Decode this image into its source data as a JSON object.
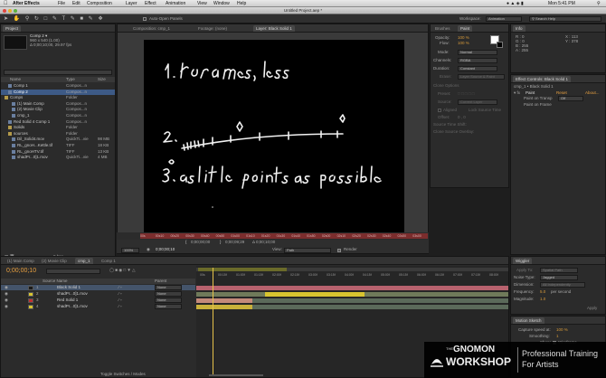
{
  "menubar": {
    "app": "After Effects",
    "menus": [
      "File",
      "Edit",
      "Composition",
      "Layer",
      "Effect",
      "Animation",
      "View",
      "Window",
      "Help"
    ],
    "title": "Untitled Project.aep *",
    "clock": "Mon 5:41 PM"
  },
  "toolbar": {
    "auto_open": "Auto-Open Panels",
    "workspace_label": "Workspace:",
    "workspace_value": "Animation",
    "search_placeholder": "Search Help"
  },
  "project": {
    "tab": "Project",
    "comp_name": "Comp 2 ▾",
    "comp_size": "960 x 540 (1.00)",
    "comp_duration": "Δ 0;00;10;00, 29.97 fps",
    "columns": {
      "name": "Name",
      "type": "Type",
      "size": "Size"
    },
    "items": [
      {
        "name": "Comp 1",
        "type": "Compos...n"
      },
      {
        "name": "Comp 2",
        "type": "Compos...n",
        "selected": true
      },
      {
        "name": "Comps",
        "type": "Folder"
      },
      {
        "name": "(1) Main Comp",
        "type": "Compos...n"
      },
      {
        "name": "(2) Movie Clip",
        "type": "Compos...n"
      },
      {
        "name": "cmp_1",
        "type": "Compos...n"
      },
      {
        "name": "Red Solid 4 Comp 1",
        "type": "Compos...n"
      },
      {
        "name": "Solids",
        "type": "Folder"
      },
      {
        "name": "sources",
        "type": "Folder"
      },
      {
        "name": "Dil_Solid4.mov",
        "type": "QuickTi...vie",
        "size": "98 MB"
      },
      {
        "name": "RL_gnoH...Kettle.tif",
        "type": "TIFF",
        "size": "18 KB"
      },
      {
        "name": "RL_gnoHTV.tif",
        "type": "TIFF",
        "size": "13 KB"
      },
      {
        "name": "shadPr...0]1.mov",
        "type": "QuickTi...vie",
        "size": "4 MB"
      }
    ],
    "bpc": "8 bpc"
  },
  "viewer": {
    "tabs": [
      "Composition: cmp_1",
      "Footage: (none)",
      "Layer: Black Solid 1"
    ],
    "handwriting": [
      "1. keyframes, less",
      "2.",
      "3. as little points as possible"
    ],
    "ruler_labels": [
      "00s",
      "00s10",
      "00s20",
      "00s30",
      "00s40",
      "00s50",
      "01s00",
      "01s10",
      "01s20",
      "01s30",
      "01s40",
      "01s50",
      "02s00",
      "02s10",
      "02s20",
      "02s30",
      "02s40",
      "02s50",
      "03s00"
    ],
    "in_time": "0;00;00;00",
    "out_time": "0;00;09;29",
    "duration": "Δ 0;00;10;00",
    "zoom": "100%",
    "current_time": "0;00;00;10",
    "view_label": "View:",
    "view_value": "Path",
    "render_label": "Render"
  },
  "brushes": {
    "tabs": [
      "Brushes",
      "Paint"
    ],
    "opacity_label": "Opacity:",
    "opacity_value": "100 %",
    "flow_label": "Flow:",
    "flow_value": "100 %",
    "mode_label": "Mode:",
    "mode_value": "Normal",
    "channels_label": "Channels:",
    "channels_value": "RGBA",
    "duration_label": "Duration:",
    "duration_value": "Constant",
    "erase_label": "Erase:",
    "erase_value": "Layer Source & Paint",
    "clone_options": "Clone Options",
    "preset_label": "Preset:",
    "source_label": "Source:",
    "source_value": "Current Layer",
    "aligned": "Aligned",
    "lock_source_time": "Lock Source Time",
    "offset_label": "Offset:",
    "offset_value": "0 , 0",
    "source_time_shift": "Source Time Shift:",
    "clone_source_overlay": "Clone Source Overlay:"
  },
  "info": {
    "tab": "Info",
    "r": "R : 0",
    "g": "G : 0",
    "b": "B : 255",
    "a": "A : 255",
    "x": "X : 113",
    "y": "Y : 378"
  },
  "effect_controls": {
    "tab": "Effect Controls: Black Solid 1",
    "path": "cmp_1 • Black Solid 1",
    "effect": "Paint",
    "reset": "Reset",
    "about": "About...",
    "on_transparent": "Paint on Transp",
    "on_transparent_value": "Off",
    "paint_on_frame": "Paint on Frame"
  },
  "wiggler": {
    "tab": "Wiggler",
    "apply_to_label": "Apply To:",
    "apply_to_value": "Spatial Path",
    "noise_type_label": "Noise Type:",
    "noise_type_value": "Jagged",
    "dimension_label": "Dimension:",
    "dimension_value": "All Independently",
    "frequency_label": "Frequency:",
    "frequency_value": "5.0",
    "frequency_unit": "per second",
    "magnitude_label": "Magnitude:",
    "magnitude_value": "1.0",
    "apply": "Apply"
  },
  "motion_sketch": {
    "tab": "Motion Sketch",
    "capture_label": "Capture speed at:",
    "capture_value": "100 %",
    "smoothing_label": "Smoothing:",
    "smoothing_value": "1",
    "show_label": "Show:",
    "show_value": "Wireframe"
  },
  "timeline": {
    "tabs": [
      "(1) Main Comp",
      "(2) Movie Clip",
      "cmp_1",
      "Comp 1"
    ],
    "timecode": "0;00;00;10",
    "column_header": "Source Name",
    "parent_header": "Parent",
    "layers": [
      {
        "num": "1",
        "name": "Black Solid 1",
        "color": "#1a1a1a",
        "parent": "None"
      },
      {
        "num": "2",
        "name": "shadPr...0]1.mov",
        "color": "#d8c430",
        "parent": "None"
      },
      {
        "num": "3",
        "name": "Red Solid 1",
        "color": "#c23030",
        "parent": "None"
      },
      {
        "num": "4",
        "name": "shadPr...0]1.mov",
        "color": "#d8c430",
        "parent": "None"
      }
    ],
    "ruler": [
      "00s",
      "00:15f",
      "01:00f",
      "01:15f",
      "02:00f",
      "02:15f",
      "03:00f",
      "03:15f",
      "04:00f",
      "04:15f",
      "05:00f",
      "05:15f",
      "06:00f",
      "06:15f",
      "07:00f",
      "07:15f",
      "08:00f"
    ],
    "toggle": "Toggle Switches / Modes"
  },
  "watermark": {
    "the": "THE",
    "gnomon": "GNOMON",
    "workshop": "WORKSHOP",
    "tagline1": "Professional Training",
    "tagline2": "For Artists"
  }
}
